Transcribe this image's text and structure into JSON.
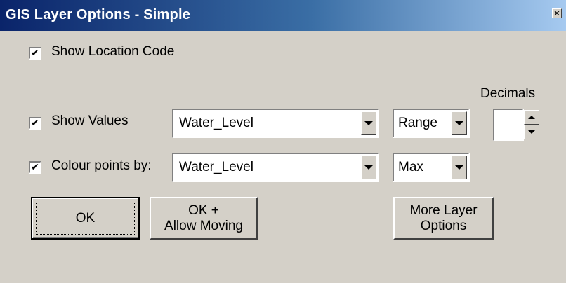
{
  "window": {
    "title": "GIS Layer Options - Simple",
    "close_glyph": "✕"
  },
  "options": {
    "show_location_code": {
      "label": "Show Location Code",
      "checked": true
    },
    "show_values": {
      "label": "Show Values",
      "checked": true,
      "field": "Water_Level",
      "mode": "Range"
    },
    "colour_points": {
      "label": "Colour points by:",
      "checked": true,
      "field": "Water_Level",
      "mode": "Max"
    },
    "decimals": {
      "label": "Decimals",
      "value": ""
    }
  },
  "buttons": {
    "ok": "OK",
    "ok_allow_moving": "OK +\nAllow Moving",
    "more_layer_options": "More Layer\nOptions"
  },
  "icons": {
    "checkmark": "✔",
    "dropdown": "chevron-down-icon",
    "spin_up": "spin-up-icon",
    "spin_down": "spin-down-icon"
  }
}
